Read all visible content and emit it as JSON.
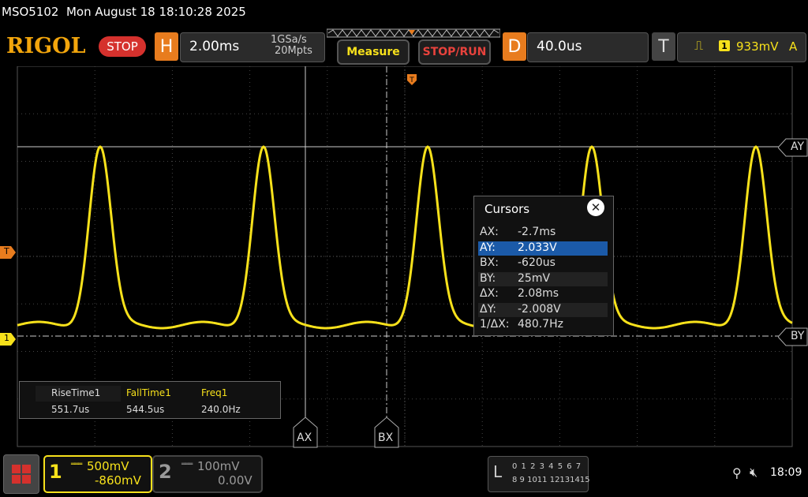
{
  "header": {
    "title_line": "MSO5102  Mon August 18 18:10:28 2025",
    "logo": "RIGOL",
    "stop_label": "STOP",
    "horizontal": {
      "letter": "H",
      "timebase": "2.00ms",
      "sample_rate": "1GSa/s",
      "memory_depth": "20Mpts"
    },
    "measure_label": "Measure",
    "stoprun_label": "STOP/RUN",
    "delay": {
      "letter": "D",
      "value": "40.0us"
    },
    "trigger": {
      "letter": "T",
      "source": "1",
      "level": "933mV",
      "mode": "A"
    }
  },
  "markers": {
    "trigger_level": "T",
    "channel1_ground": "1",
    "ay_label": "AY",
    "by_label": "BY",
    "ax_label": "AX",
    "bx_label": "BX"
  },
  "cursors": {
    "title": "Cursors",
    "rows": [
      {
        "key": "AX:",
        "value": "-2.7ms"
      },
      {
        "key": "AY:",
        "value": "2.033V",
        "selected": true
      },
      {
        "key": "BX:",
        "value": "-620us"
      },
      {
        "key": "BY:",
        "value": "25mV"
      },
      {
        "key": "ΔX:",
        "value": "2.08ms"
      },
      {
        "key": "ΔY:",
        "value": "-2.008V"
      },
      {
        "key": "1/ΔX:",
        "value": "480.7Hz"
      }
    ]
  },
  "measurements": [
    {
      "label": "RiseTime1",
      "value": "551.7us"
    },
    {
      "label": "FallTime1",
      "value": "544.5us"
    },
    {
      "label": "Freq1",
      "value": "240.0Hz"
    }
  ],
  "channels": {
    "ch1": {
      "number": "1",
      "scale": "500mV",
      "offset": "-860mV",
      "color": "#f7e11b"
    },
    "ch2": {
      "number": "2",
      "scale": "100mV",
      "offset": "0.00V",
      "color": "#999999"
    }
  },
  "logic": {
    "letter": "L",
    "row1": "0 1 2 3  4 5 6 7",
    "row2": "8 9 1011 12131415"
  },
  "status": {
    "clock": "18:09",
    "usb_icon": "usb-icon",
    "speaker_icon": "speaker-muted-icon"
  },
  "waveform": {
    "color": "#f7e11b",
    "shape": "periodic pulse peaks, 5 visible"
  }
}
